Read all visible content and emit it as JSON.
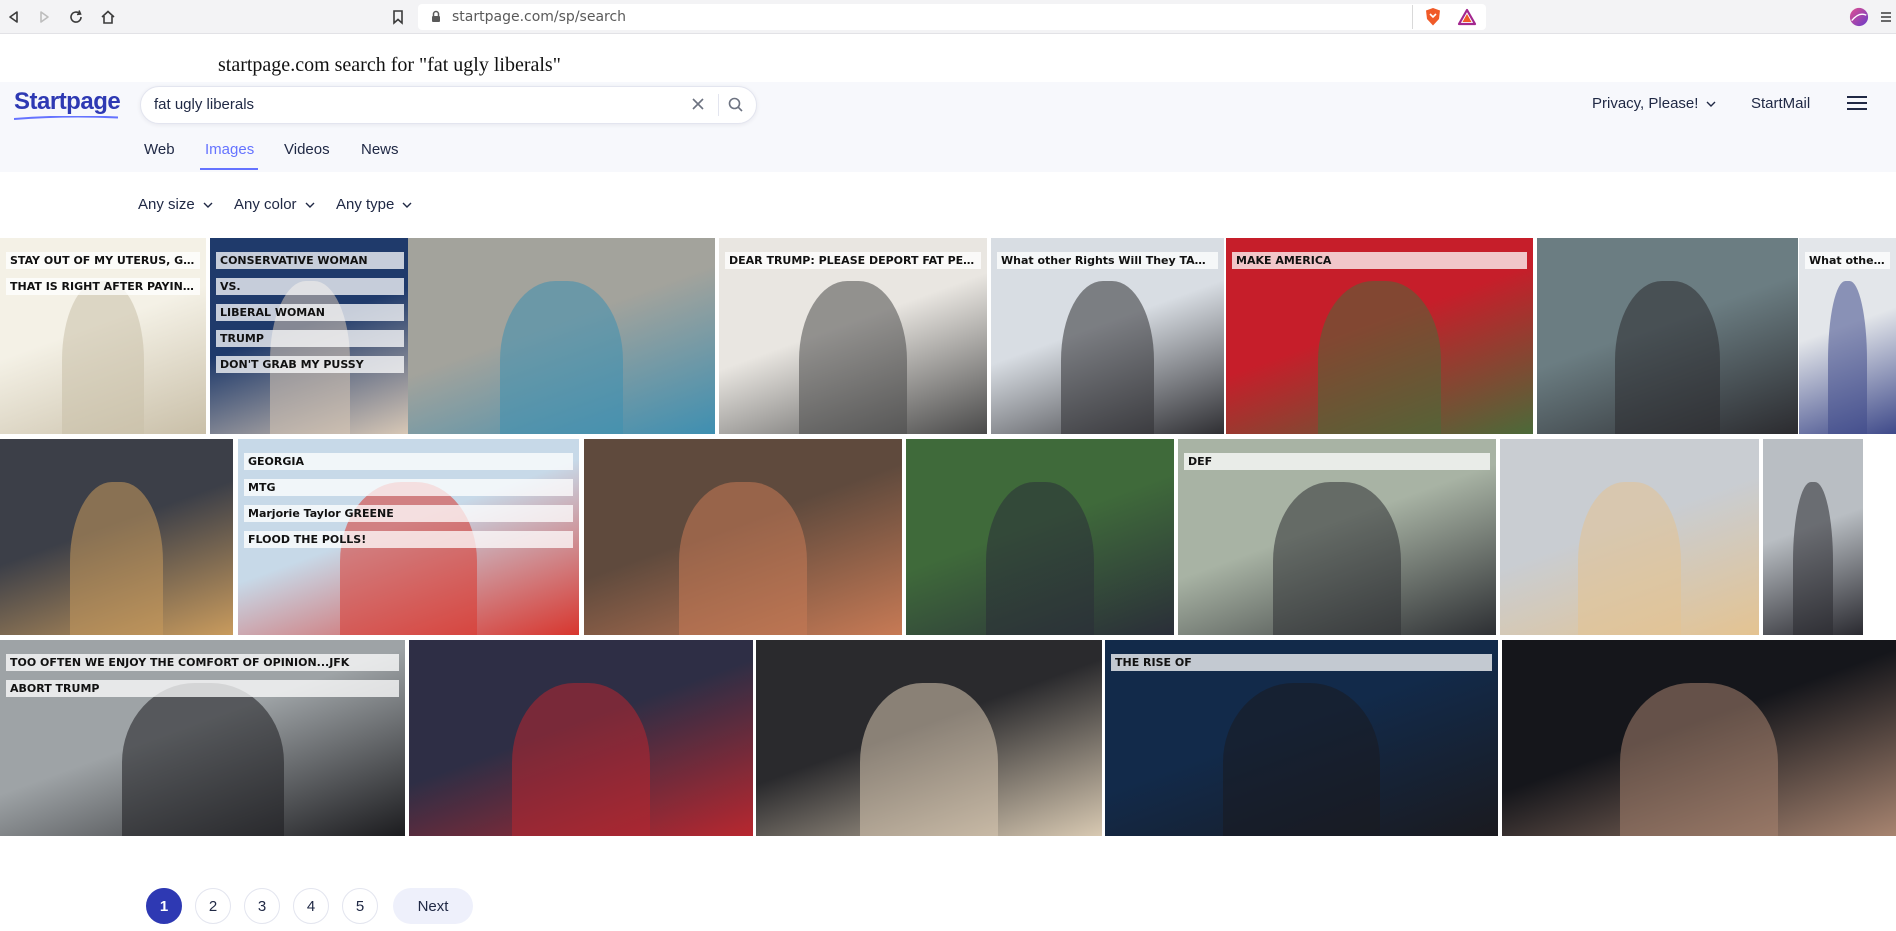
{
  "browser": {
    "url": "startpage.com/sp/search",
    "icons": [
      "back-icon",
      "forward-icon",
      "reload-icon",
      "home-icon",
      "bookmark-icon",
      "lock-icon",
      "brave-shield-icon",
      "brave-rewards-icon",
      "profile-icon",
      "menu-icon"
    ]
  },
  "caption": "startpage.com search for \"fat ugly liberals\"",
  "header": {
    "logo": "Startpage",
    "search_value": "fat ugly liberals",
    "privacy_label": "Privacy, Please!",
    "startmail_label": "StartMail"
  },
  "tabs": [
    {
      "label": "Web",
      "active": false
    },
    {
      "label": "Images",
      "active": true
    },
    {
      "label": "Videos",
      "active": false
    },
    {
      "label": "News",
      "active": false
    }
  ],
  "filters": [
    {
      "label": "Any size"
    },
    {
      "label": "Any color"
    },
    {
      "label": "Any type"
    }
  ],
  "images": {
    "row1": [
      {
        "name": "cartoon-uterus-government",
        "caption_texts": [
          "STAY OUT OF MY UTERUS, GOVERNMENT!!",
          "THAT IS RIGHT AFTER PAYING FOR MY FREE BIRTH CONTROL"
        ],
        "colors": [
          "#f4f1e6",
          "#c9bfa8"
        ]
      },
      {
        "name": "conservative-vs-liberal-woman",
        "caption_texts": [
          "CONSERVATIVE WOMAN",
          "VS.",
          "LIBERAL WOMAN",
          "TRUMP",
          "DON'T GRAB MY PUSSY"
        ],
        "colors": [
          "#1f3a6b",
          "#d8c8b6"
        ]
      },
      {
        "name": "woman-blue-hair",
        "caption_texts": [],
        "colors": [
          "#a3a39c",
          "#3e8fb1"
        ]
      },
      {
        "name": "man-holding-sign",
        "caption_texts": [
          "DEAR TRUMP: PLEASE DEPORT FAT PEOPLE"
        ],
        "colors": [
          "#e9e6e1",
          "#4a4a4a"
        ]
      },
      {
        "name": "protest-supreme-court",
        "caption_texts": [
          "What other Rights Will They TAKE Away?"
        ],
        "colors": [
          "#d8dde3",
          "#2f2f33"
        ]
      },
      {
        "name": "comic-make-america",
        "caption_texts": [
          "MAKE AMERICA"
        ],
        "colors": [
          "#c61e2a",
          "#4b6a39"
        ]
      },
      {
        "name": "blonde-woman-profile",
        "caption_texts": [],
        "colors": [
          "#6b7d82",
          "#2b2b2f"
        ]
      },
      {
        "name": "protest-sign-rights",
        "caption_texts": [
          "What other Rights Will They TAKE Away?"
        ],
        "colors": [
          "#e3e6ea",
          "#3f4a8a"
        ]
      }
    ],
    "row2": [
      {
        "name": "trump-mcdonalds-plane",
        "caption_texts": [],
        "colors": [
          "#3c3f48",
          "#c99b5d"
        ]
      },
      {
        "name": "mtg-supporters",
        "caption_texts": [
          "GEORGIA",
          "MTG",
          "Marjorie Taylor GREENE",
          "FLOOD THE POLLS!"
        ],
        "colors": [
          "#c7d9e8",
          "#d8362e"
        ]
      },
      {
        "name": "trump-closeup-child",
        "caption_texts": [],
        "colors": [
          "#5f4a3d",
          "#c77a55"
        ]
      },
      {
        "name": "woman-speaking-microphone",
        "caption_texts": [],
        "colors": [
          "#3f6a3a",
          "#2a2e39"
        ]
      },
      {
        "name": "men-protest-banner",
        "caption_texts": [
          "DEF"
        ],
        "colors": [
          "#a8b3a4",
          "#2d2f33"
        ]
      },
      {
        "name": "blonde-woman-smiling",
        "caption_texts": [],
        "colors": [
          "#c9cdd2",
          "#e4c391"
        ]
      },
      {
        "name": "woman-protest-signs",
        "caption_texts": [],
        "colors": [
          "#b9bec3",
          "#2a2a30"
        ]
      }
    ],
    "row3": [
      {
        "name": "abort-trump-protest",
        "caption_texts": [
          "TOO OFTEN WE ENJOY THE COMFORT OF OPINION...JFK",
          "ABORT TRUMP"
        ],
        "colors": [
          "#9ea3a6",
          "#1c1c1f"
        ]
      },
      {
        "name": "trump-rally-crowd",
        "caption_texts": [],
        "colors": [
          "#2e2e45",
          "#b8272f"
        ]
      },
      {
        "name": "rush-limbaugh-clapping",
        "caption_texts": [],
        "colors": [
          "#2a2a2d",
          "#d8c9b2"
        ]
      },
      {
        "name": "gina-carano-red-carpet",
        "caption_texts": [
          "THE RISE OF"
        ],
        "colors": [
          "#122a4a",
          "#1a1a1f"
        ]
      },
      {
        "name": "nancy-pelosi",
        "caption_texts": [],
        "colors": [
          "#15161b",
          "#a78470"
        ]
      }
    ]
  },
  "pagination": {
    "pages": [
      "1",
      "2",
      "3",
      "4",
      "5"
    ],
    "current": "1",
    "next_label": "Next"
  }
}
